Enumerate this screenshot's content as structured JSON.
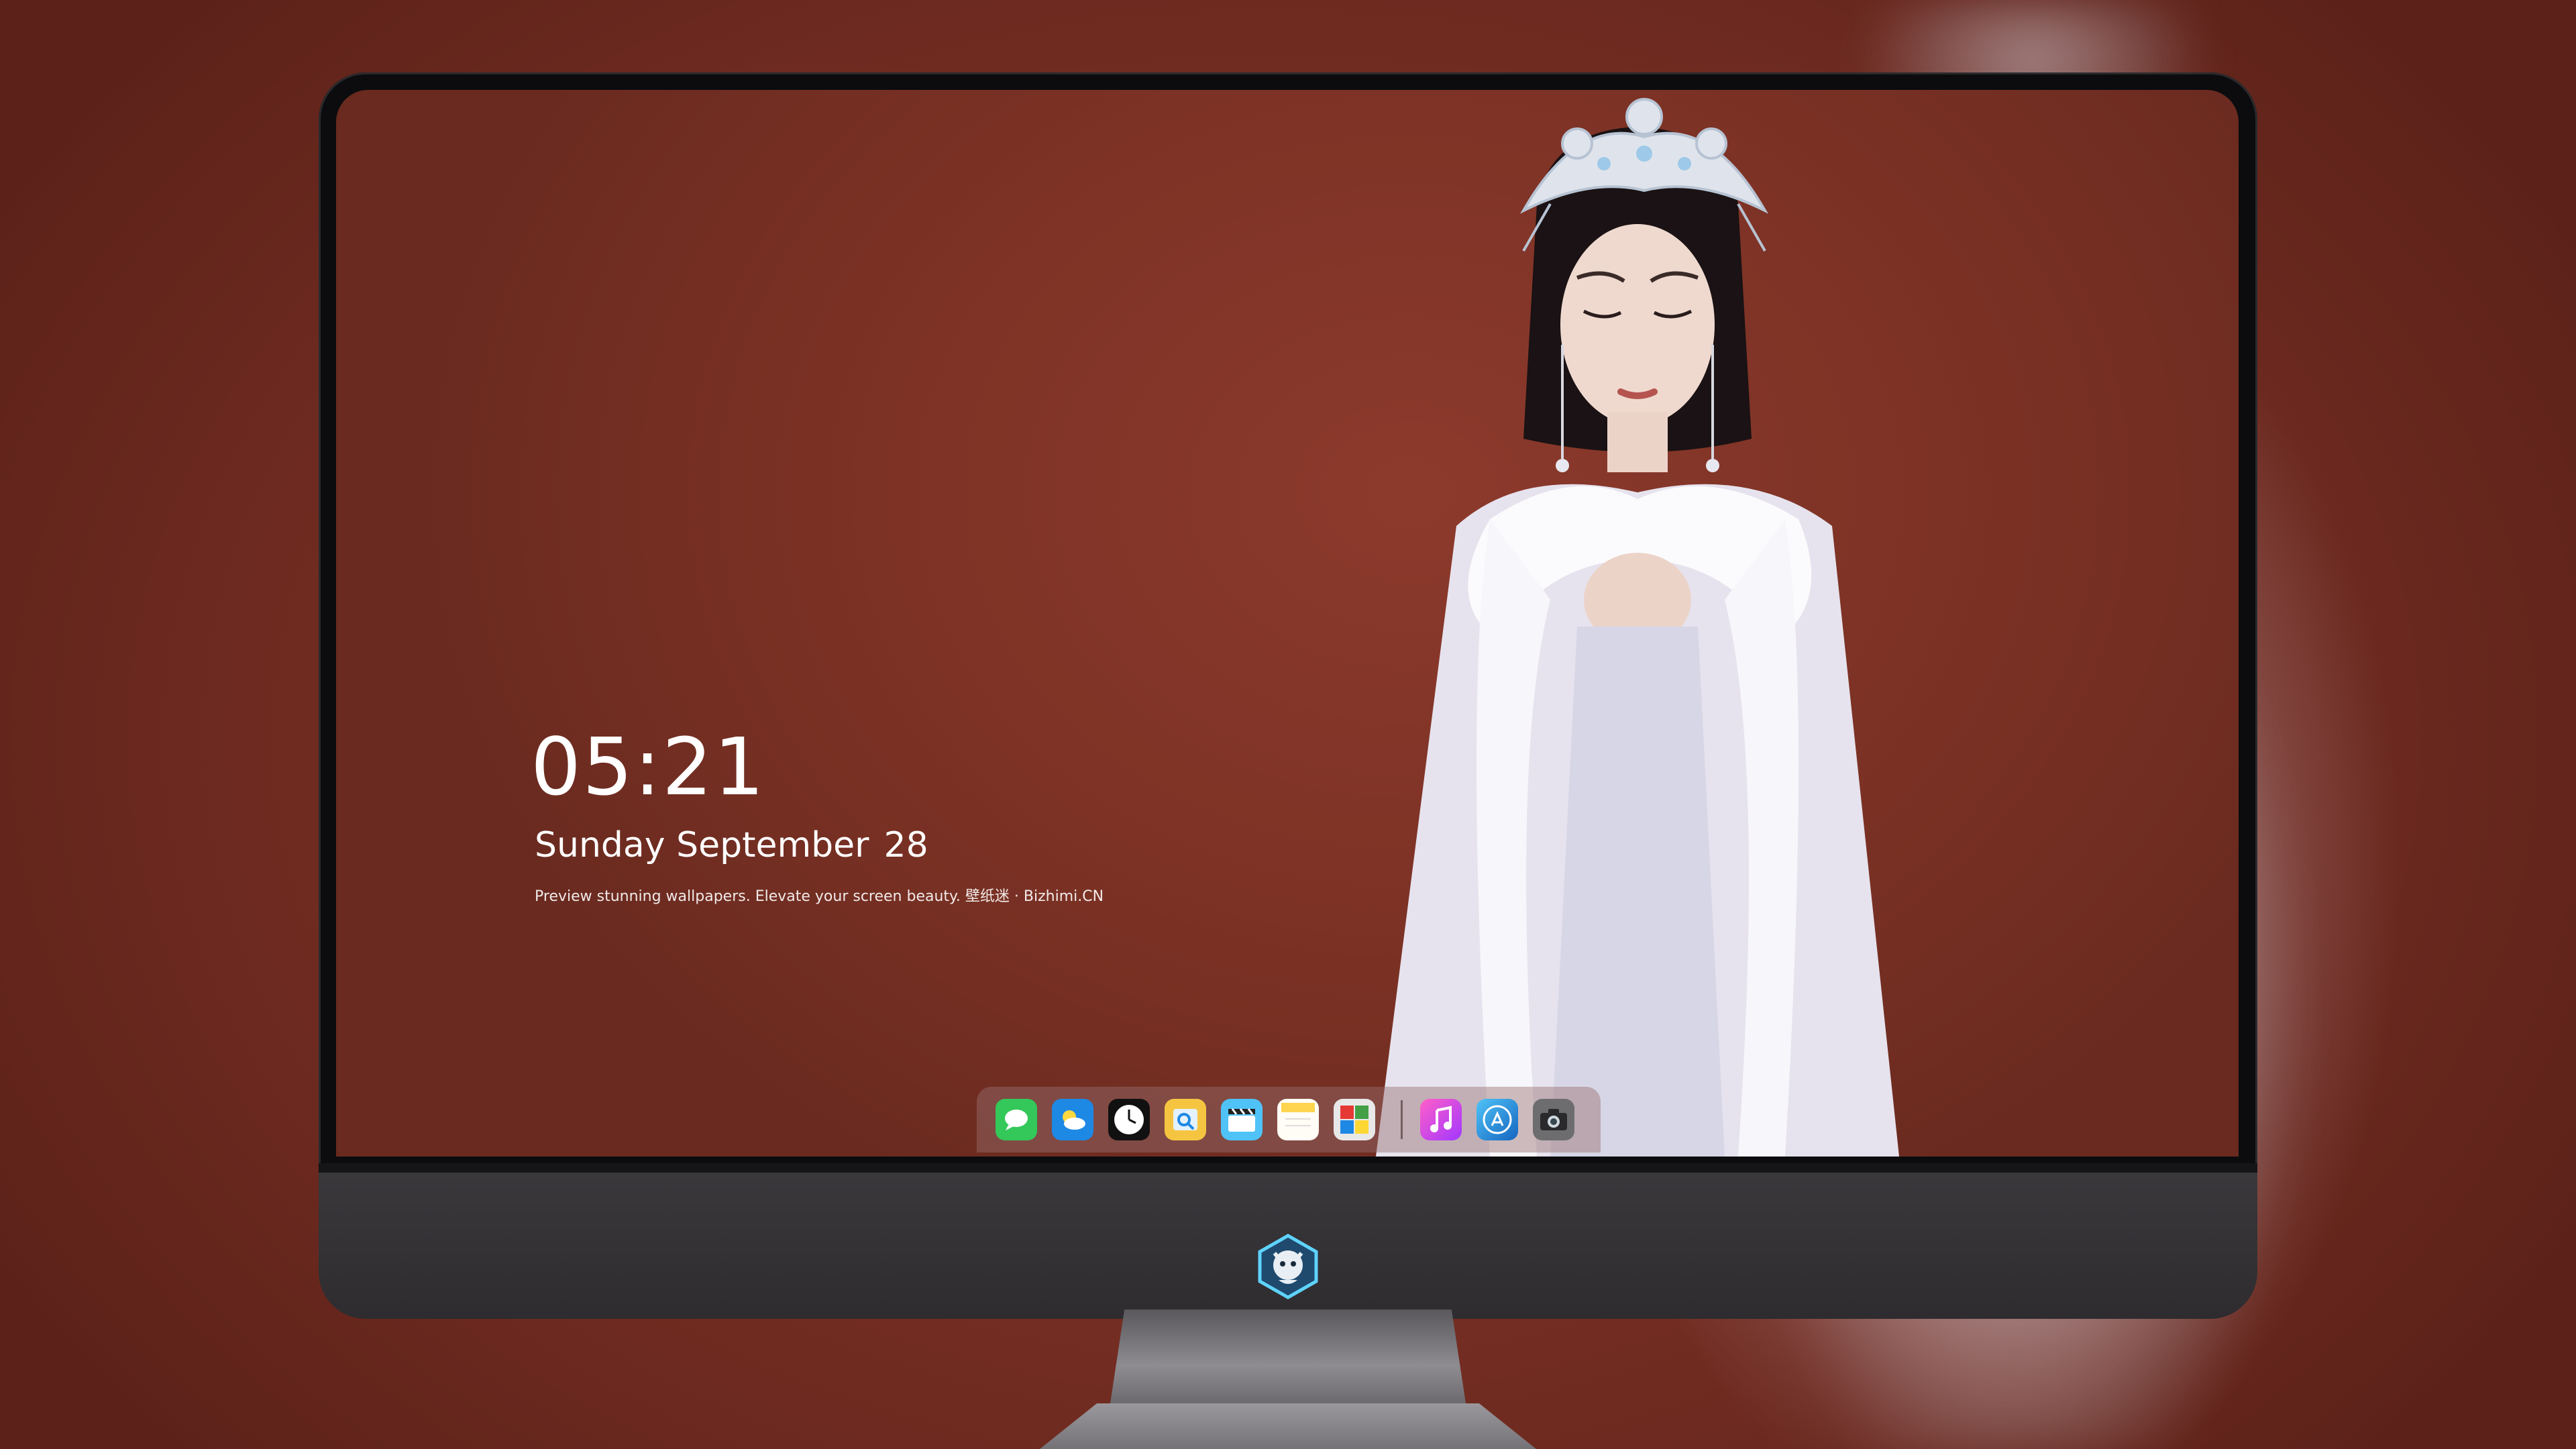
{
  "lockscreen": {
    "time": "05:21",
    "date_weekday_month": "Sunday September",
    "date_day": "28",
    "tagline": "Preview stunning wallpapers. Elevate your screen beauty. 壁纸迷 · Bizhimi.CN"
  },
  "dock": {
    "apps": [
      {
        "name": "messages-icon",
        "color": "#34c759"
      },
      {
        "name": "weather-icon",
        "color": "#1e88e5"
      },
      {
        "name": "clock-icon",
        "color": "#111111"
      },
      {
        "name": "preview-icon",
        "color": "#f5c542"
      },
      {
        "name": "clips-icon",
        "color": "#4fc3f7"
      },
      {
        "name": "notes-icon",
        "color": "#ffd54f"
      },
      {
        "name": "photos-icon",
        "color": "#e8e8e8"
      },
      {
        "name": "music-icon",
        "color": "#c03adf"
      },
      {
        "name": "app-store-icon",
        "color": "#1e88e5"
      },
      {
        "name": "camera-icon",
        "color": "#6d6d6f"
      }
    ]
  },
  "monitor": {
    "logo": "mascot-logo-icon"
  }
}
